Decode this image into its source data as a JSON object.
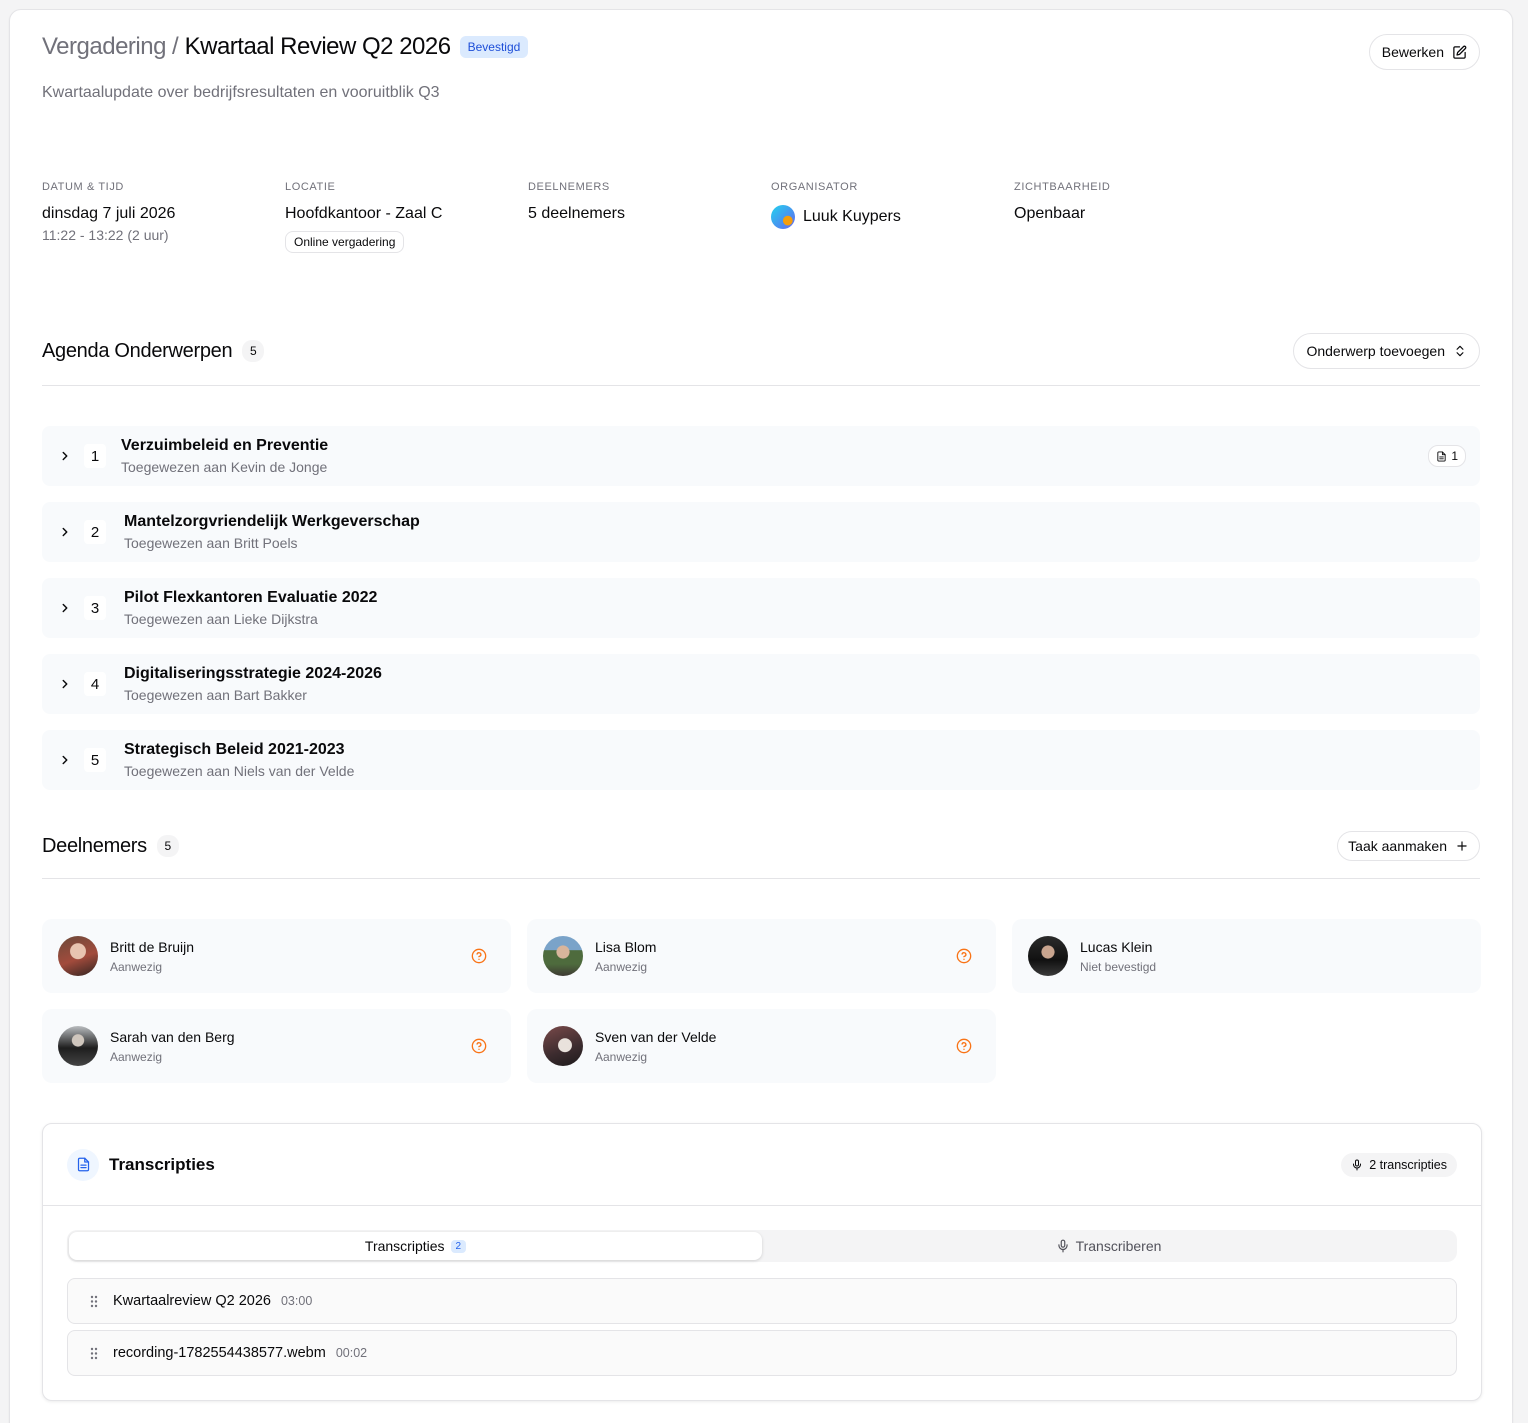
{
  "header": {
    "breadcrumb_parent": "Vergadering",
    "breadcrumb_sep": "/",
    "title": "Kwartaal Review Q2 2026",
    "status": "Bevestigd",
    "subtitle": "Kwartaalupdate over bedrijfsresultaten en vooruitblik Q3",
    "edit_label": "Bewerken"
  },
  "meta": {
    "datetime_label": "DATUM & TIJD",
    "date": "dinsdag 7 juli 2026",
    "time": "11:22 - 13:22 (2 uur)",
    "location_label": "LOCATIE",
    "location": "Hoofdkantoor - Zaal C",
    "online_badge": "Online vergadering",
    "participants_label": "DEELNEMERS",
    "participants": "5 deelnemers",
    "organizer_label": "ORGANISATOR",
    "organizer": "Luuk Kuypers",
    "visibility_label": "ZICHTBAARHEID",
    "visibility": "Openbaar"
  },
  "agenda": {
    "title": "Agenda Onderwerpen",
    "count": "5",
    "add_label": "Onderwerp toevoegen",
    "items": [
      {
        "num": "1",
        "title": "Verzuimbeleid en Preventie",
        "assignee": "Toegewezen aan Kevin de Jonge",
        "docs": "1"
      },
      {
        "num": "2",
        "title": "Mantelzorgvriendelijk Werkgeverschap",
        "assignee": "Toegewezen aan Britt Poels"
      },
      {
        "num": "3",
        "title": "Pilot Flexkantoren Evaluatie 2022",
        "assignee": "Toegewezen aan Lieke Dijkstra"
      },
      {
        "num": "4",
        "title": "Digitaliseringsstrategie 2024-2026",
        "assignee": "Toegewezen aan Bart Bakker"
      },
      {
        "num": "5",
        "title": "Strategisch Beleid 2021-2023",
        "assignee": "Toegewezen aan Niels van der Velde"
      }
    ]
  },
  "participants": {
    "title": "Deelnemers",
    "count": "5",
    "task_label": "Taak aanmaken",
    "items": [
      {
        "name": "Britt de Bruijn",
        "status": "Aanwezig",
        "icon": "help-circle-icon"
      },
      {
        "name": "Lisa Blom",
        "status": "Aanwezig",
        "icon": "help-circle-icon"
      },
      {
        "name": "Lucas Klein",
        "status": "Niet bevestigd"
      },
      {
        "name": "Sarah van den Berg",
        "status": "Aanwezig",
        "icon": "help-circle-icon"
      },
      {
        "name": "Sven van der Velde",
        "status": "Aanwezig",
        "icon": "help-circle-icon"
      }
    ]
  },
  "transcripts": {
    "title": "Transcripties",
    "count_label": "2 transcripties",
    "tab_list": "Transcripties",
    "tab_list_count": "2",
    "tab_record": "Transcriberen",
    "items": [
      {
        "name": "Kwartaalreview Q2 2026",
        "duration": "03:00"
      },
      {
        "name": "recording-1782554438577.webm",
        "duration": "00:02"
      }
    ]
  },
  "colors": {
    "accent_blue": "#1d4ed8",
    "badge_blue_bg": "#dbeafe",
    "warning_orange": "#f97316",
    "row_bg": "#f8fafc",
    "border": "#e4e4e7"
  }
}
